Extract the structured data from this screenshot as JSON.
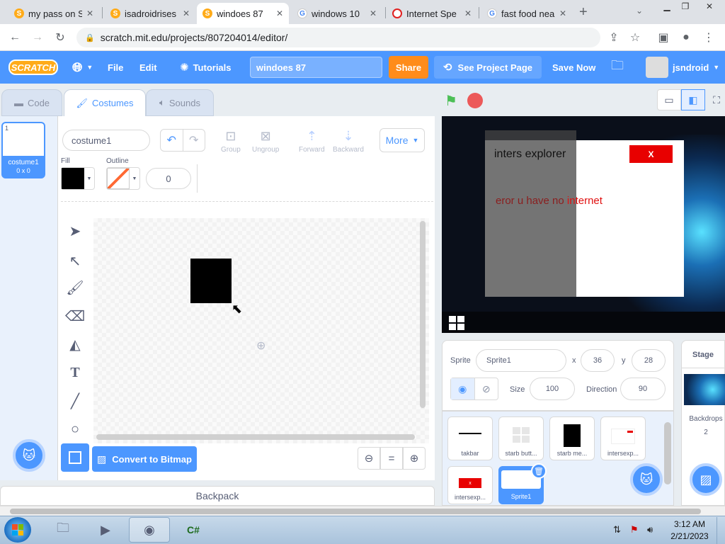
{
  "browser": {
    "tabs": [
      {
        "title": "my pass on S",
        "icon": "scratch-favicon",
        "active": false
      },
      {
        "title": "isadroidrises",
        "icon": "scratch-favicon",
        "active": false
      },
      {
        "title": "windoes 87 ",
        "icon": "scratch-favicon",
        "active": true
      },
      {
        "title": "windows 10 ",
        "icon": "google-favicon",
        "active": false
      },
      {
        "title": "Internet Spe",
        "icon": "speedtest-favicon",
        "active": false
      },
      {
        "title": "fast food nea",
        "icon": "google-favicon",
        "active": false
      }
    ],
    "url": "scratch.mit.edu/projects/807204014/editor/"
  },
  "menubar": {
    "logo": "SCRATCH",
    "file": "File",
    "edit": "Edit",
    "tutorials": "Tutorials",
    "project_title": "windoes 87",
    "share": "Share",
    "see_project": "See Project Page",
    "save_now": "Save Now",
    "username": "jsndroid"
  },
  "editor_tabs": {
    "code": "Code",
    "costumes": "Costumes",
    "sounds": "Sounds"
  },
  "costume_list": [
    {
      "index": "1",
      "name": "costume1",
      "size": "0 x 0"
    }
  ],
  "paint": {
    "costume_name": "costume1",
    "fill_label": "Fill",
    "outline_label": "Outline",
    "outline_width": "0",
    "group": "Group",
    "ungroup": "Ungroup",
    "forward": "Forward",
    "backward": "Backward",
    "more": "More",
    "convert": "Convert to Bitmap",
    "zoom_reset": "="
  },
  "backpack": "Backpack",
  "stage": {
    "dialog_title": "inters explorer",
    "close_label": "X",
    "error_text_1": "eror u have no ",
    "error_text_2": "internet"
  },
  "sprite_info": {
    "sprite_label": "Sprite",
    "sprite_name": "Sprite1",
    "x_label": "x",
    "x": "36",
    "y_label": "y",
    "y": "28",
    "size_label": "Size",
    "size": "100",
    "direction_label": "Direction",
    "direction": "90"
  },
  "sprites": [
    {
      "name": "takbar"
    },
    {
      "name": "starb butt..."
    },
    {
      "name": "starb me..."
    },
    {
      "name": "intersexp..."
    },
    {
      "name": "intersexp..."
    },
    {
      "name": "Sprite1"
    }
  ],
  "stage_pane": {
    "title": "Stage",
    "backdrops_label": "Backdrops",
    "backdrops_count": "2"
  },
  "taskbar": {
    "time": "3:12 AM",
    "date": "2/21/2023"
  },
  "colors": {
    "scratch_blue": "#4c97ff",
    "share_orange": "#ff8c1a",
    "flag_green": "#4cbf56",
    "stop_red": "#ec5959"
  }
}
